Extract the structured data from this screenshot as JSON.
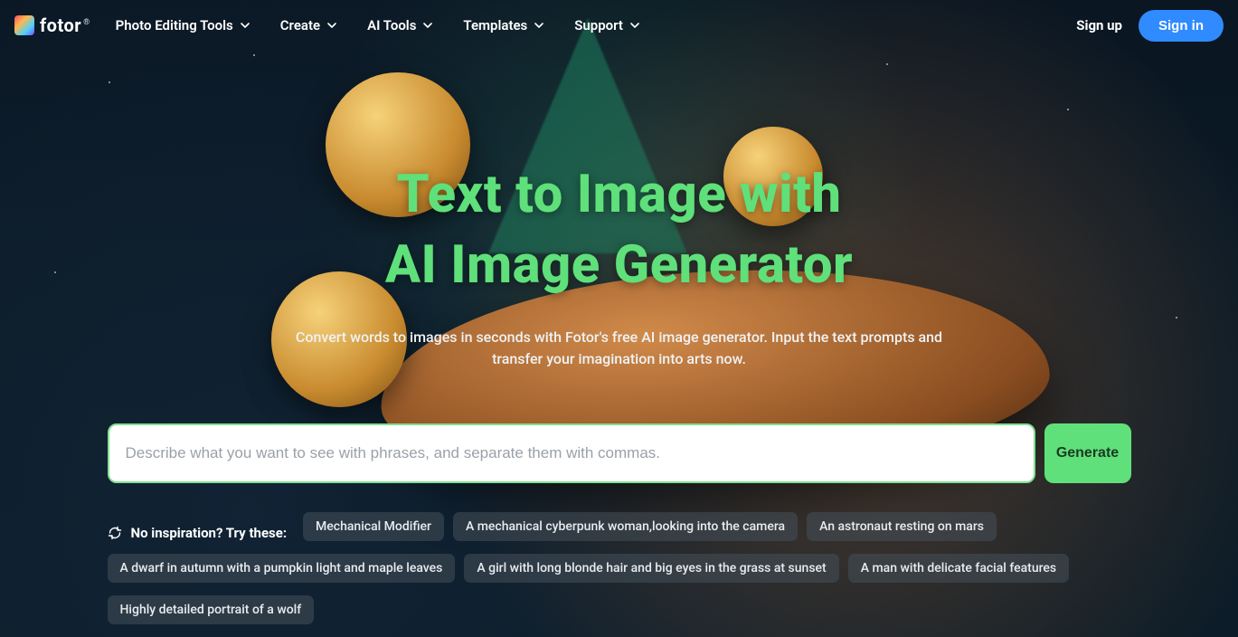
{
  "brand": {
    "name": "fotor",
    "reg": "®"
  },
  "nav": {
    "items": [
      {
        "label": "Photo Editing Tools"
      },
      {
        "label": "Create"
      },
      {
        "label": "AI Tools"
      },
      {
        "label": "Templates"
      },
      {
        "label": "Support"
      }
    ]
  },
  "auth": {
    "signup": "Sign up",
    "signin": "Sign in"
  },
  "hero": {
    "title_line1": "Text to Image with",
    "title_line2": "AI Image Generator",
    "subtitle": "Convert words to images in seconds with Fotor's free AI image generator. Input the text prompts and transfer your imagination into arts now."
  },
  "prompt": {
    "placeholder": "Describe what you want to see with phrases, and separate them with commas.",
    "value": "",
    "generate_label": "Generate"
  },
  "inspiration": {
    "heading": "No inspiration? Try these:",
    "chips": [
      "Mechanical Modifier",
      "A mechanical cyberpunk woman,looking into the camera",
      "An astronaut resting on mars",
      "A dwarf in autumn with a pumpkin light and maple leaves",
      "A girl with long blonde hair and big eyes in the grass at sunset",
      "A man with delicate facial features",
      "Highly detailed portrait of a wolf"
    ]
  },
  "colors": {
    "accent_green": "#5fe07a",
    "accent_blue": "#2f8bff"
  }
}
